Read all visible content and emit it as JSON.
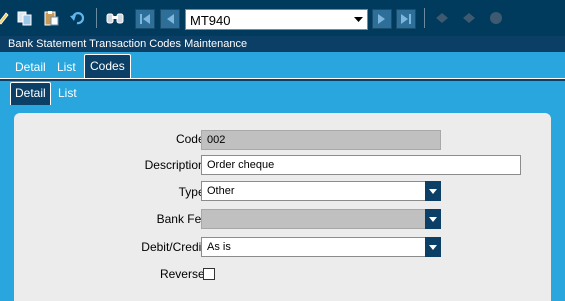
{
  "toolbar": {
    "record_selector_value": "MT940",
    "icons": [
      "tools-icon",
      "copy-icon",
      "paste-icon",
      "undo-icon",
      "find-icon",
      "first-record-icon",
      "previous-record-icon",
      "next-record-icon",
      "last-record-icon",
      "edit-icon",
      "delete-icon",
      "options-icon"
    ]
  },
  "window": {
    "title": "Bank Statement Transaction Codes Maintenance"
  },
  "outer_tabs": [
    {
      "label": "Detail",
      "active": false
    },
    {
      "label": "List",
      "active": false
    },
    {
      "label": "Codes",
      "active": true
    }
  ],
  "inner_tabs": [
    {
      "label": "Detail",
      "active": true
    },
    {
      "label": "List",
      "active": false
    }
  ],
  "form": {
    "code": {
      "label": "Code:",
      "value": "002"
    },
    "description": {
      "label": "Description:",
      "value": "Order cheque"
    },
    "type": {
      "label": "Type:",
      "value": "Other"
    },
    "bank_fee": {
      "label": "Bank Fee",
      "value": ""
    },
    "debit_credit": {
      "label": "Debit/Credit:",
      "value": "As is"
    },
    "reverse": {
      "label": "Reverse:",
      "checked": false
    }
  },
  "colors": {
    "toolbar_bg": "#003a5c",
    "title_bg": "#0b3f66",
    "tab_strip": "#29a6de",
    "panel_bg": "#ececec",
    "readonly_field": "#c0c0c0"
  }
}
